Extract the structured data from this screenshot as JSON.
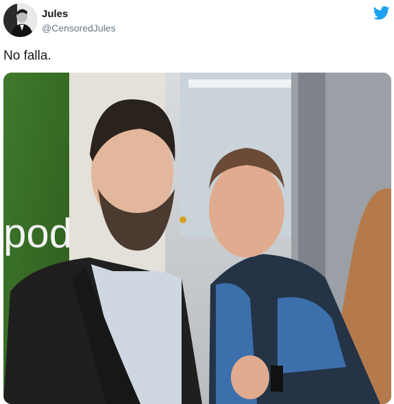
{
  "tweet": {
    "author_name": "Jules",
    "author_handle": "@CensoredJules",
    "text": "No falla.",
    "brand_color": "#1da1f2"
  },
  "icons": {
    "brand": "twitter-bird-icon"
  },
  "media": {
    "poster_text": "pod"
  }
}
